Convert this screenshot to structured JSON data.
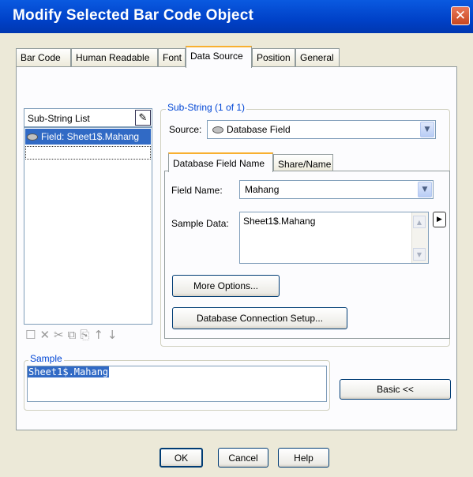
{
  "window": {
    "title": "Modify Selected Bar Code Object",
    "close_glyph": "✕"
  },
  "tabs": [
    {
      "label": "Bar Code"
    },
    {
      "label": "Human Readable"
    },
    {
      "label": "Font"
    },
    {
      "label": "Data Source",
      "active": true
    },
    {
      "label": "Position"
    },
    {
      "label": "General"
    }
  ],
  "substring_list": {
    "header": "Sub-String List",
    "items": [
      "Field: Sheet1$.Mahang"
    ],
    "toolbar_icons": [
      "new-icon",
      "delete-icon",
      "cut-icon",
      "copy-icon",
      "paste-icon",
      "move-up-icon",
      "move-down-icon"
    ]
  },
  "substring_group": {
    "legend": "Sub-String (1 of 1)",
    "source_label": "Source:",
    "source_value": "Database Field"
  },
  "inner_tabs": [
    {
      "label": "Database Field Name",
      "active": true
    },
    {
      "label": "Share/Name"
    }
  ],
  "field_name": {
    "label": "Field Name:",
    "value": "Mahang"
  },
  "sample_data": {
    "label": "Sample Data:",
    "value": "Sheet1$.Mahang"
  },
  "buttons": {
    "more_options": "More Options...",
    "db_connection": "Database Connection Setup...",
    "basic": "Basic <<",
    "ok": "OK",
    "cancel": "Cancel",
    "help": "Help"
  },
  "sample": {
    "legend": "Sample",
    "value": "Sheet1$.Mahang"
  }
}
